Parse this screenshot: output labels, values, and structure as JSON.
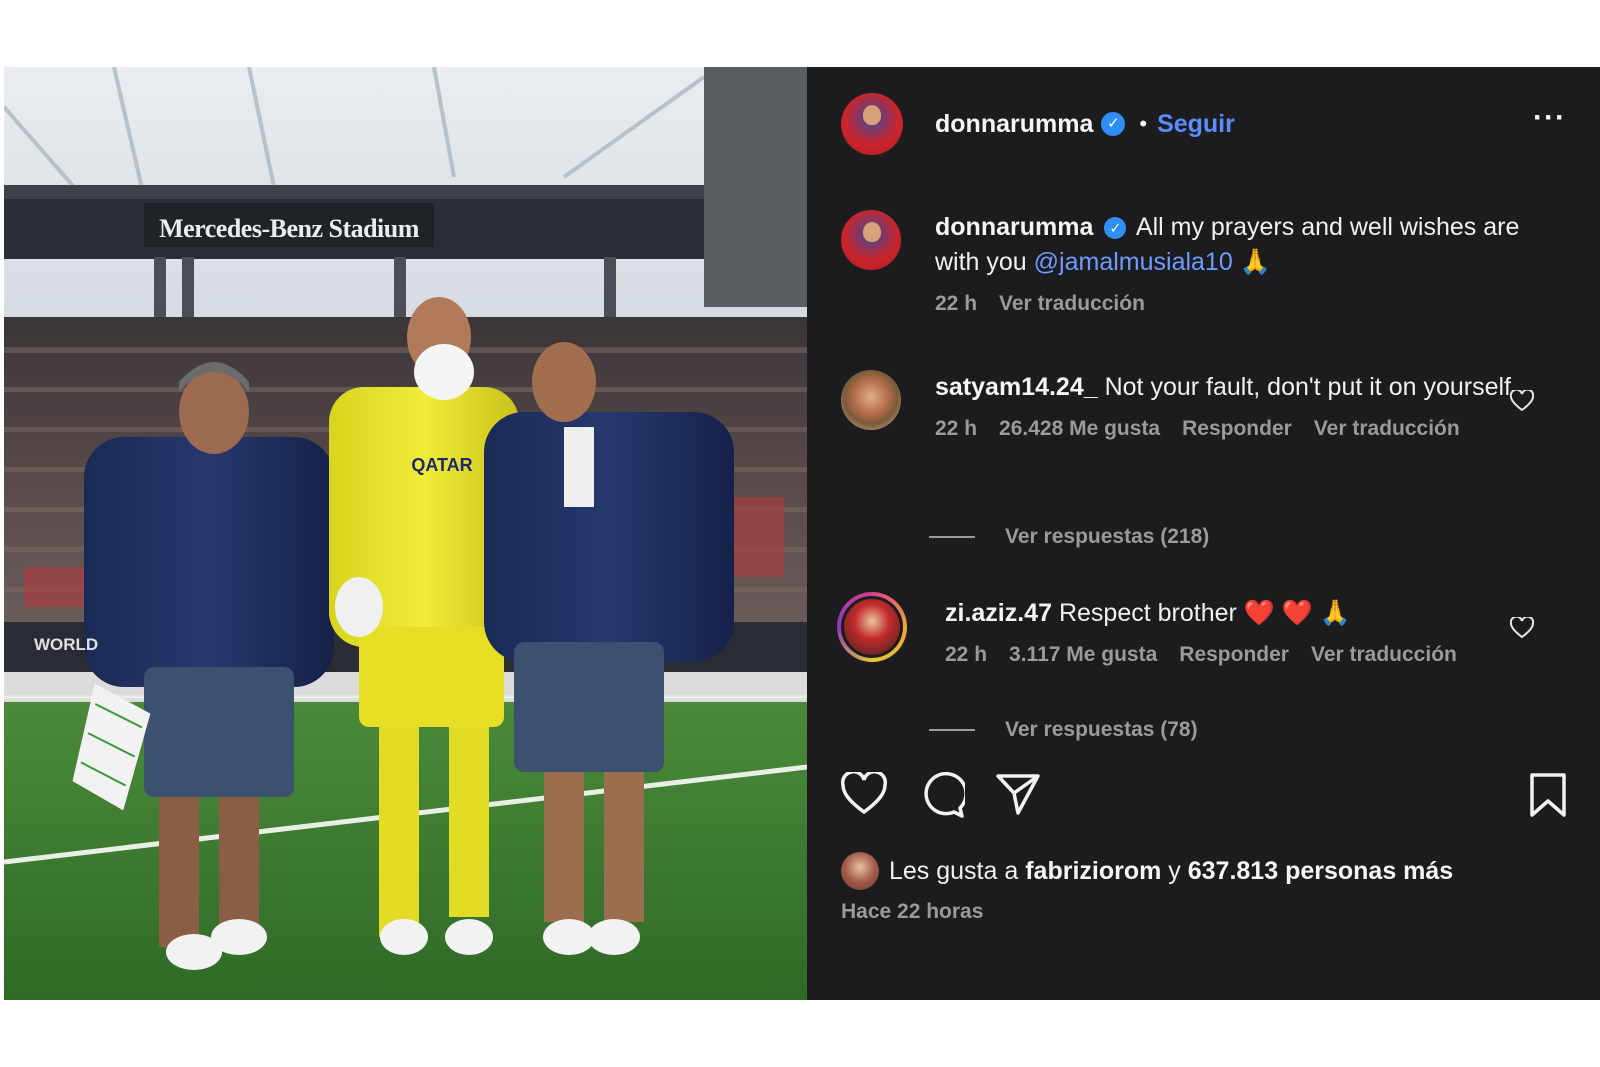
{
  "photo": {
    "stadium_sign": "Mercedes-Benz Stadium",
    "board_text": "WORLD",
    "shirt_text": "QATAR"
  },
  "header": {
    "username": "donnarumma",
    "follow_label": "Seguir",
    "more_label": "···"
  },
  "caption": {
    "username": "donnarumma",
    "text": "All my prayers and well wishes are with you",
    "mention": "@jamalmusiala10",
    "emoji": "🙏",
    "time": "22 h",
    "translate_label": "Ver traducción"
  },
  "comments": [
    {
      "username": "satyam14.24_",
      "text": "Not your fault, don't put it on yourself",
      "time": "22 h",
      "likes": "26.428 Me gusta",
      "reply_label": "Responder",
      "translate_label": "Ver traducción",
      "view_replies": "Ver respuestas (218)"
    },
    {
      "username": "zi.aziz.47",
      "text": "Respect brother ❤️ ❤️ 🙏",
      "time": "22 h",
      "likes": "3.117 Me gusta",
      "reply_label": "Responder",
      "translate_label": "Ver traducción",
      "view_replies": "Ver respuestas (78)"
    }
  ],
  "likes": {
    "prefix": "Les gusta a",
    "user": "fabriziorom",
    "connector": "y",
    "count": "637.813 personas más"
  },
  "time_ago": "Hace 22 horas",
  "colors": {
    "panel_bg": "#1c1c1e",
    "link_blue": "#5b8cff",
    "verified_blue": "#2f8ff4",
    "muted_text": "#9a9a9a"
  },
  "icons": [
    "heart-icon",
    "comment-icon",
    "share-icon",
    "bookmark-icon",
    "more-icon",
    "verified-icon"
  ]
}
